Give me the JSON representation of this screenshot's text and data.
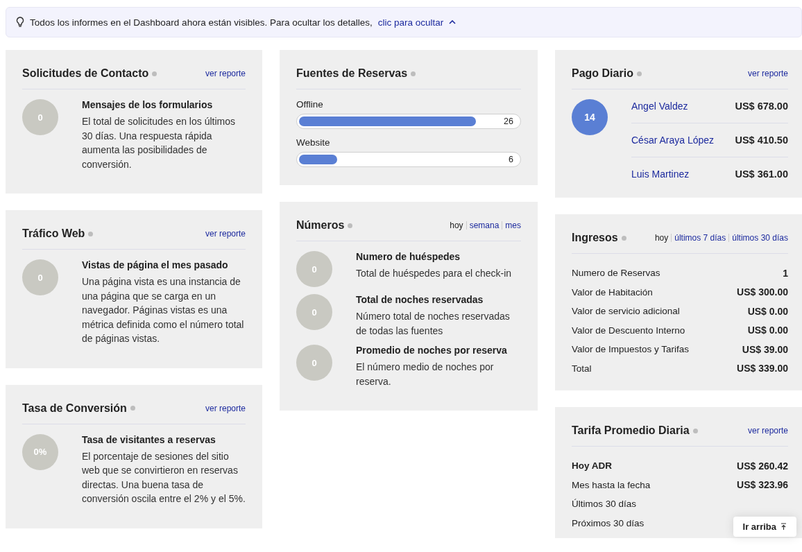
{
  "banner": {
    "text": "Todos los informes en el Dashboard ahora están visibles. Para ocultar los detalles,",
    "link": "clic para ocultar"
  },
  "columns": [
    [
      {
        "kind": "stat",
        "title": "Solicitudes de Contacto",
        "report": "ver reporte",
        "circle": "0",
        "heading": "Mensajes de los formularios",
        "text": "El total de solicitudes en los últimos 30 días. Una respuesta rápida aumenta las posibilidades de conversión."
      },
      {
        "kind": "stat",
        "title": "Tráfico Web",
        "report": "ver reporte",
        "circle": "0",
        "heading": "Vistas de página el mes pasado",
        "text": "Una página vista es una instancia de una página que se carga en un navegador. Páginas vistas es una métrica definida como el número total de páginas vistas."
      },
      {
        "kind": "stat",
        "title": "Tasa de Conversión",
        "report": "ver reporte",
        "circle": "0%",
        "heading": "Tasa de visitantes a reservas",
        "text": "El porcentaje de sesiones del sitio web que se convirtieron en reservas directas. Una buena tasa de conversión oscila entre el 2% y el 5%."
      }
    ],
    [
      {
        "kind": "bars",
        "title": "Fuentes de Reservas",
        "bars": [
          {
            "label": "Offline",
            "value": "26",
            "level": 0.81
          },
          {
            "label": "Website",
            "value": "6",
            "level": 0.19
          }
        ]
      },
      {
        "kind": "multi",
        "title": "Números",
        "periods": [
          {
            "label": "hoy",
            "selected": true
          },
          {
            "label": "semana",
            "selected": false
          },
          {
            "label": "mes",
            "selected": false
          }
        ],
        "items": [
          {
            "circle": "0",
            "heading": "Numero de huéspedes",
            "text": "Total de huéspedes para el check-in"
          },
          {
            "circle": "0",
            "heading": "Total de noches reservadas",
            "text": "Número total de noches reservadas de todas las fuentes"
          },
          {
            "circle": "0",
            "heading": "Promedio de noches por reserva",
            "text": "El número medio de noches por reserva."
          }
        ]
      }
    ],
    [
      {
        "kind": "payments",
        "title": "Pago Diario",
        "report": "ver reporte",
        "circle": "14",
        "rows": [
          {
            "name": "Angel Valdez",
            "amount": "US$ 678.00"
          },
          {
            "name": "César Araya López",
            "amount": "US$ 410.50"
          },
          {
            "name": "Luis Martinez",
            "amount": "US$ 361.00"
          }
        ]
      },
      {
        "kind": "table",
        "title": "Ingresos",
        "periods": [
          {
            "label": "hoy",
            "selected": true
          },
          {
            "label": "últimos 7 días",
            "selected": false
          },
          {
            "label": "últimos 30 días",
            "selected": false
          }
        ],
        "rows": [
          {
            "label": "Numero de Reservas",
            "value": "1"
          },
          {
            "label": "Valor de Habitación",
            "value": "US$ 300.00"
          },
          {
            "label": "Valor de servicio adicional",
            "value": "US$ 0.00"
          },
          {
            "label": "Valor de Descuento Interno",
            "value": "US$ 0.00"
          },
          {
            "label": "Valor de Impuestos y Tarifas",
            "value": "US$ 39.00"
          },
          {
            "label": "Total",
            "value": "US$ 339.00"
          }
        ]
      },
      {
        "kind": "table",
        "title": "Tarifa Promedio Diaria",
        "report": "ver reporte",
        "rows": [
          {
            "label": "Hoy ADR",
            "value": "US$ 260.42",
            "bold": true
          },
          {
            "label": "Mes hasta la fecha",
            "value": "US$ 323.96",
            "bold": false
          },
          {
            "label": "Últimos 30 días",
            "bold": false
          },
          {
            "label": "Próximos 30 días",
            "bold": false
          }
        ]
      }
    ]
  ],
  "scroll_top": {
    "label": "Ir arriba"
  }
}
